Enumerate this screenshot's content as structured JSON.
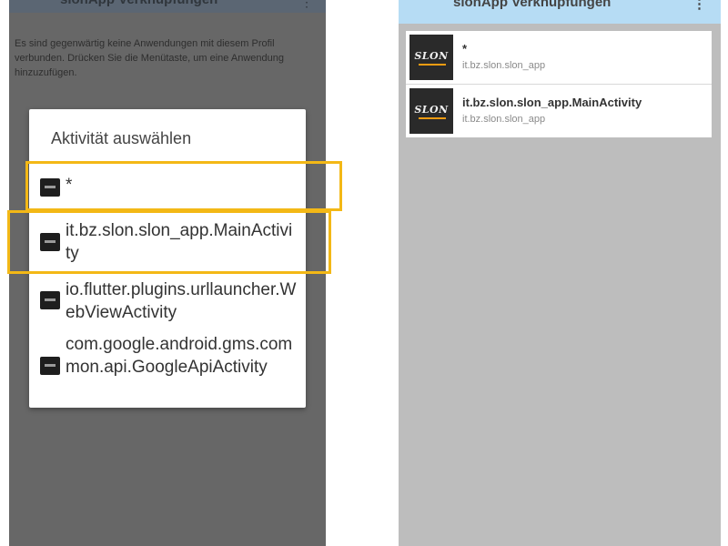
{
  "left": {
    "appbar_title": "slonApp Verknüpfungen",
    "empty_message": "Es sind gegenwärtig keine Anwendungen mit diesem Profil verbunden. Drücken Sie die Menütaste, um eine Anwendung hinzuzufügen.",
    "dialog": {
      "title": "Aktivität auswählen",
      "items": [
        {
          "label": "*"
        },
        {
          "label": "it.bz.slon.slon_app.MainActivity"
        },
        {
          "label": "io.flutter.plugins.urllauncher.WebViewActivity"
        },
        {
          "label": "com.google.android.gms.common.api.GoogleApiActivity"
        }
      ]
    }
  },
  "right": {
    "appbar_title": "slonApp Verknüpfungen",
    "more_icon": "⋮",
    "shortcuts": [
      {
        "title": "*",
        "subtitle": "it.bz.slon.slon_app",
        "icon_text": "SLON"
      },
      {
        "title": "it.bz.slon.slon_app.MainActivity",
        "subtitle": "it.bz.slon.slon_app",
        "icon_text": "SLON"
      }
    ]
  },
  "colors": {
    "highlight": "#f3b816",
    "right_appbar": "#b6dcf4"
  }
}
